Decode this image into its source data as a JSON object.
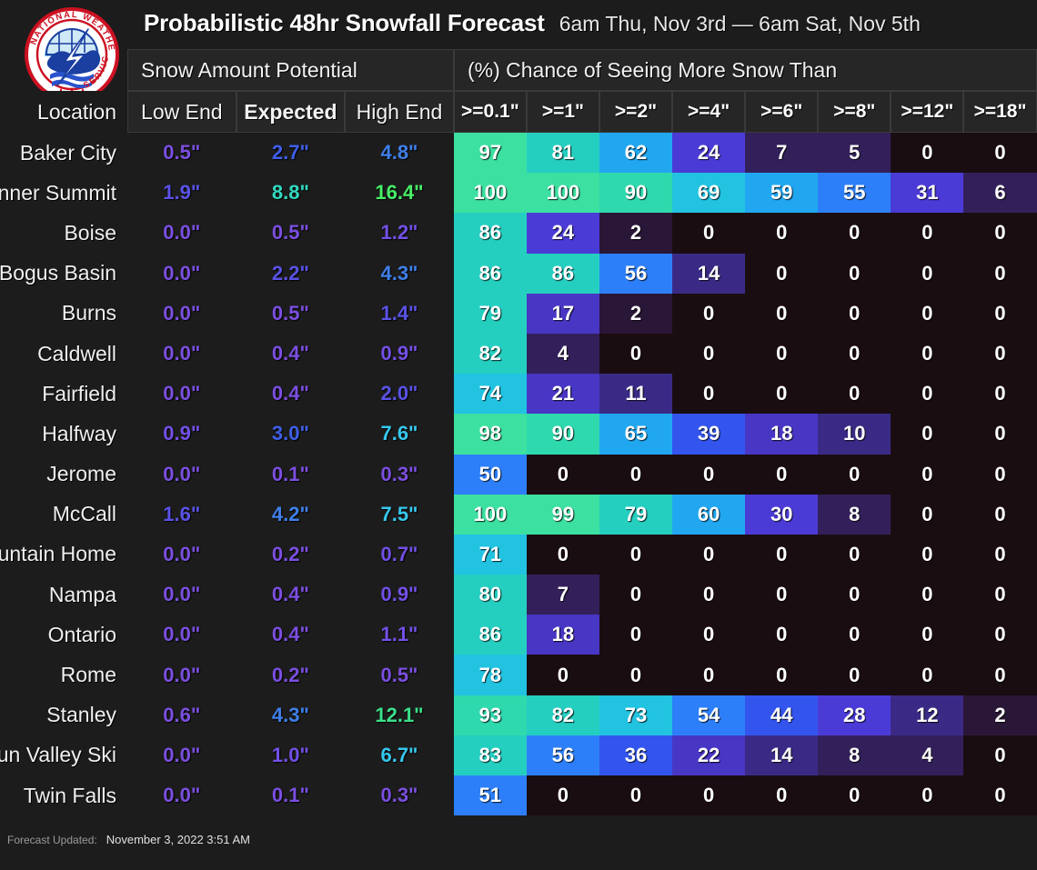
{
  "header": {
    "title": "Probabilistic 48hr Snowfall Forecast",
    "subtitle": "6am Thu, Nov 3rd — 6am Sat, Nov 5th",
    "logo_alt": "National Weather Service",
    "band_left": "Snow Amount Potential",
    "band_right": "(%) Chance of Seeing More Snow Than"
  },
  "columns": {
    "location": "Location",
    "amounts": [
      "Low End",
      "Expected",
      "High End"
    ],
    "probs": [
      ">=0.1\"",
      ">=1\"",
      ">=2\"",
      ">=4\"",
      ">=6\"",
      ">=8\"",
      ">=12\"",
      ">=18\""
    ]
  },
  "footer": {
    "label": "Forecast Updated:",
    "value": "November 3, 2022 3:51 AM"
  },
  "chart_data": {
    "type": "heatmap",
    "title": "Probabilistic 48hr Snowfall Forecast",
    "subtitle": "6am Thu, Nov 3rd — 6am Sat, Nov 5th",
    "xlabel": "",
    "ylabel": "Location",
    "amount_columns": [
      "Low End",
      "Expected",
      "High End"
    ],
    "prob_thresholds": [
      ">=0.1\"",
      ">=1\"",
      ">=2\"",
      ">=4\"",
      ">=6\"",
      ">=8\"",
      ">=12\"",
      ">=18\""
    ],
    "prob_units": "%",
    "amount_units": "inches",
    "value_range": [
      0,
      100
    ],
    "rows": [
      {
        "location": "Baker City",
        "low": "0.5\"",
        "expected": "2.7\"",
        "high": "4.8\"",
        "low_val": 0.5,
        "expected_val": 2.7,
        "high_val": 4.8,
        "probs": [
          97,
          81,
          62,
          24,
          7,
          5,
          0,
          0
        ]
      },
      {
        "location": "Banner Summit",
        "low": "1.9\"",
        "expected": "8.8\"",
        "high": "16.4\"",
        "low_val": 1.9,
        "expected_val": 8.8,
        "high_val": 16.4,
        "probs": [
          100,
          100,
          90,
          69,
          59,
          55,
          31,
          6
        ]
      },
      {
        "location": "Boise",
        "low": "0.0\"",
        "expected": "0.5\"",
        "high": "1.2\"",
        "low_val": 0.0,
        "expected_val": 0.5,
        "high_val": 1.2,
        "probs": [
          86,
          24,
          2,
          0,
          0,
          0,
          0,
          0
        ]
      },
      {
        "location": "Bogus Basin",
        "low": "0.0\"",
        "expected": "2.2\"",
        "high": "4.3\"",
        "low_val": 0.0,
        "expected_val": 2.2,
        "high_val": 4.3,
        "probs": [
          86,
          86,
          56,
          14,
          0,
          0,
          0,
          0
        ]
      },
      {
        "location": "Burns",
        "low": "0.0\"",
        "expected": "0.5\"",
        "high": "1.4\"",
        "low_val": 0.0,
        "expected_val": 0.5,
        "high_val": 1.4,
        "probs": [
          79,
          17,
          2,
          0,
          0,
          0,
          0,
          0
        ]
      },
      {
        "location": "Caldwell",
        "low": "0.0\"",
        "expected": "0.4\"",
        "high": "0.9\"",
        "low_val": 0.0,
        "expected_val": 0.4,
        "high_val": 0.9,
        "probs": [
          82,
          4,
          0,
          0,
          0,
          0,
          0,
          0
        ]
      },
      {
        "location": "Fairfield",
        "low": "0.0\"",
        "expected": "0.4\"",
        "high": "2.0\"",
        "low_val": 0.0,
        "expected_val": 0.4,
        "high_val": 2.0,
        "probs": [
          74,
          21,
          11,
          0,
          0,
          0,
          0,
          0
        ]
      },
      {
        "location": "Halfway",
        "low": "0.9\"",
        "expected": "3.0\"",
        "high": "7.6\"",
        "low_val": 0.9,
        "expected_val": 3.0,
        "high_val": 7.6,
        "probs": [
          98,
          90,
          65,
          39,
          18,
          10,
          0,
          0
        ]
      },
      {
        "location": "Jerome",
        "low": "0.0\"",
        "expected": "0.1\"",
        "high": "0.3\"",
        "low_val": 0.0,
        "expected_val": 0.1,
        "high_val": 0.3,
        "probs": [
          50,
          0,
          0,
          0,
          0,
          0,
          0,
          0
        ]
      },
      {
        "location": "McCall",
        "low": "1.6\"",
        "expected": "4.2\"",
        "high": "7.5\"",
        "low_val": 1.6,
        "expected_val": 4.2,
        "high_val": 7.5,
        "probs": [
          100,
          99,
          79,
          60,
          30,
          8,
          0,
          0
        ]
      },
      {
        "location": "Mountain Home",
        "low": "0.0\"",
        "expected": "0.2\"",
        "high": "0.7\"",
        "low_val": 0.0,
        "expected_val": 0.2,
        "high_val": 0.7,
        "probs": [
          71,
          0,
          0,
          0,
          0,
          0,
          0,
          0
        ]
      },
      {
        "location": "Nampa",
        "low": "0.0\"",
        "expected": "0.4\"",
        "high": "0.9\"",
        "low_val": 0.0,
        "expected_val": 0.4,
        "high_val": 0.9,
        "probs": [
          80,
          7,
          0,
          0,
          0,
          0,
          0,
          0
        ]
      },
      {
        "location": "Ontario",
        "low": "0.0\"",
        "expected": "0.4\"",
        "high": "1.1\"",
        "low_val": 0.0,
        "expected_val": 0.4,
        "high_val": 1.1,
        "probs": [
          86,
          18,
          0,
          0,
          0,
          0,
          0,
          0
        ]
      },
      {
        "location": "Rome",
        "low": "0.0\"",
        "expected": "0.2\"",
        "high": "0.5\"",
        "low_val": 0.0,
        "expected_val": 0.2,
        "high_val": 0.5,
        "probs": [
          78,
          0,
          0,
          0,
          0,
          0,
          0,
          0
        ]
      },
      {
        "location": "Stanley",
        "low": "0.6\"",
        "expected": "4.3\"",
        "high": "12.1\"",
        "low_val": 0.6,
        "expected_val": 4.3,
        "high_val": 12.1,
        "probs": [
          93,
          82,
          73,
          54,
          44,
          28,
          12,
          2
        ]
      },
      {
        "location": "Sun Valley Ski",
        "low": "0.0\"",
        "expected": "1.0\"",
        "high": "6.7\"",
        "low_val": 0.0,
        "expected_val": 1.0,
        "high_val": 6.7,
        "probs": [
          83,
          56,
          36,
          22,
          14,
          8,
          4,
          0
        ]
      },
      {
        "location": "Twin Falls",
        "low": "0.0\"",
        "expected": "0.1\"",
        "high": "0.3\"",
        "low_val": 0.0,
        "expected_val": 0.1,
        "high_val": 0.3,
        "probs": [
          51,
          0,
          0,
          0,
          0,
          0,
          0,
          0
        ]
      }
    ]
  },
  "colors": {
    "background": "#1c1c1c",
    "header_cell": "#262626",
    "grid_line": "#3a3a3a",
    "prob_zero": "#1a0d12",
    "prob_low": "#2e1a47",
    "prob_mid_violet": "#4b3bd6",
    "prob_mid_blue": "#2d7ff9",
    "prob_cyan": "#22c3e0",
    "prob_teal": "#25cfc0",
    "prob_green": "#3ce0a0",
    "amt_violet": "#7b4fe0",
    "amt_blue": "#3f5fe8",
    "amt_cyan": "#36c8ee",
    "amt_green": "#48ef68"
  }
}
